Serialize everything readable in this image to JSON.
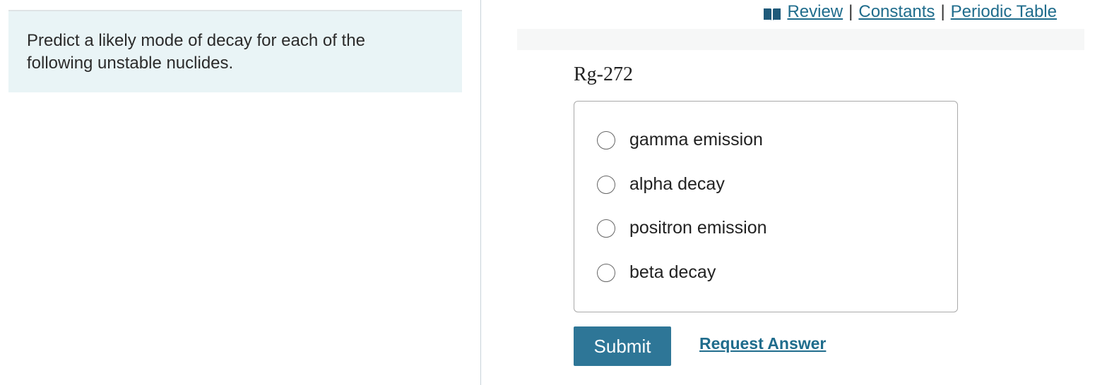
{
  "prompt": {
    "text": "Predict a likely mode of decay for each of the following unstable nuclides."
  },
  "toplinks": {
    "icon": "book-icon",
    "review": "Review",
    "separator": "|",
    "constants": "Constants",
    "periodic_table": "Periodic Table"
  },
  "question": {
    "label": "Rg-272",
    "options": [
      {
        "label": "gamma emission",
        "selected": false
      },
      {
        "label": "alpha decay",
        "selected": false
      },
      {
        "label": "positron emission",
        "selected": false
      },
      {
        "label": "beta decay",
        "selected": false
      }
    ]
  },
  "actions": {
    "submit": "Submit",
    "request_answer": "Request Answer"
  },
  "colors": {
    "link": "#1f6c8c",
    "button": "#2e7697",
    "prompt_bg": "#e9f4f6"
  }
}
